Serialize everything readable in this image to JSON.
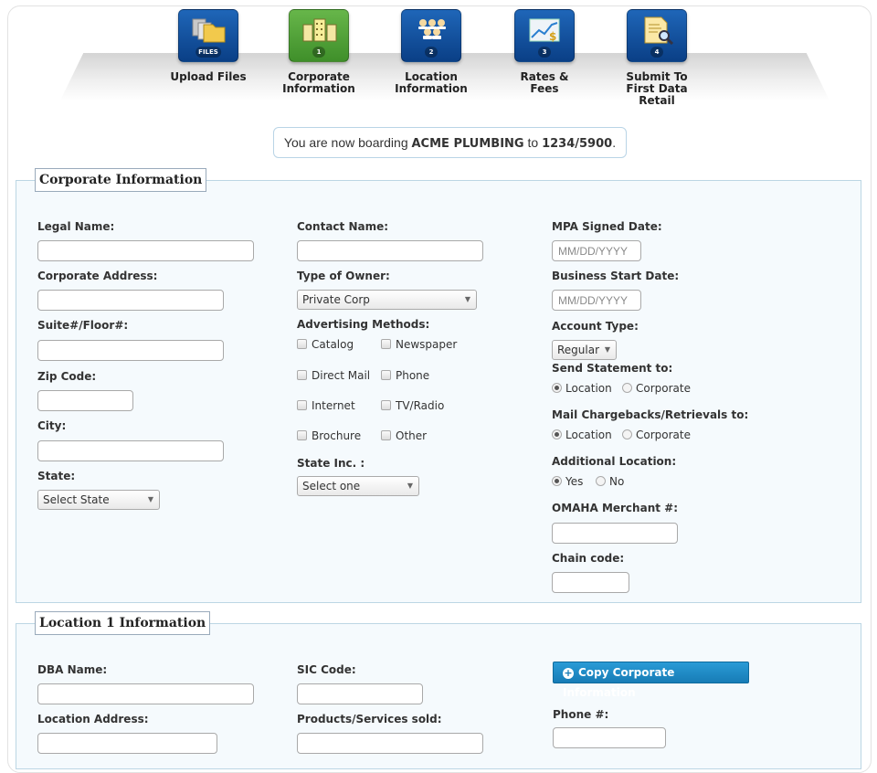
{
  "wizard": {
    "steps": [
      {
        "label": "Upload Files",
        "badge": "FILES",
        "icon": "files-icon",
        "color": "#0d4a96"
      },
      {
        "label": "Corporate\nInformation",
        "badge": "1",
        "icon": "buildings-icon",
        "color": "#4ea23a"
      },
      {
        "label": "Location\nInformation",
        "badge": "2",
        "icon": "people-icon",
        "color": "#0d4a96"
      },
      {
        "label": "Rates &\nFees",
        "badge": "3",
        "icon": "chart-dollar-icon",
        "color": "#0d4a96"
      },
      {
        "label": "Submit To\nFirst Data Retail",
        "badge": "4",
        "icon": "document-search-icon",
        "color": "#0d4a96"
      }
    ]
  },
  "banner": {
    "prefix": "You are now boarding ",
    "merchant": "ACME PLUMBING",
    "middle": " to ",
    "target": "1234/5900",
    "suffix": "."
  },
  "corporate": {
    "legend": "Corporate Information",
    "legal_name_label": "Legal Name:",
    "legal_name_value": "",
    "corporate_address_label": "Corporate Address:",
    "corporate_address_value": "",
    "suite_label": "Suite#/Floor#:",
    "suite_value": "",
    "zip_label": "Zip Code:",
    "zip_value": "",
    "city_label": "City:",
    "city_value": "",
    "state_label": "State:",
    "state_value": "Select State",
    "contact_name_label": "Contact Name:",
    "contact_name_value": "",
    "type_owner_label": "Type of Owner:",
    "type_owner_value": "Private Corp",
    "advertising_label": "Advertising Methods:",
    "advertising_options": [
      "Catalog",
      "Newspaper",
      "Direct Mail",
      "Phone",
      "Internet",
      "TV/Radio",
      "Brochure",
      "Other"
    ],
    "state_inc_label": "State Inc. :",
    "state_inc_value": "Select one",
    "mpa_date_label": "MPA Signed Date:",
    "mpa_date_placeholder": "MM/DD/YYYY",
    "business_start_label": "Business Start Date:",
    "business_start_placeholder": "MM/DD/YYYY",
    "account_type_label": "Account Type:",
    "account_type_value": "Regular",
    "send_statement_label": "Send Statement to:",
    "send_statement_options": [
      "Location",
      "Corporate"
    ],
    "send_statement_selected": "Location",
    "mail_chargebacks_label": "Mail Chargebacks/Retrievals to:",
    "mail_chargebacks_options": [
      "Location",
      "Corporate"
    ],
    "mail_chargebacks_selected": "Location",
    "additional_location_label": "Additional Location:",
    "additional_location_options": [
      "Yes",
      "No"
    ],
    "additional_location_selected": "Yes",
    "omaha_label": "OMAHA Merchant #:",
    "omaha_value": "",
    "chain_code_label": "Chain code:",
    "chain_code_value": ""
  },
  "location": {
    "legend": "Location 1 Information",
    "dba_label": "DBA Name:",
    "dba_value": "",
    "location_address_label": "Location Address:",
    "location_address_value": "",
    "sic_label": "SIC Code:",
    "sic_value": "",
    "products_label": "Products/Services sold:",
    "products_value": "",
    "copy_button_label": "Copy Corporate Information",
    "phone_label": "Phone #:",
    "phone_value": ""
  }
}
